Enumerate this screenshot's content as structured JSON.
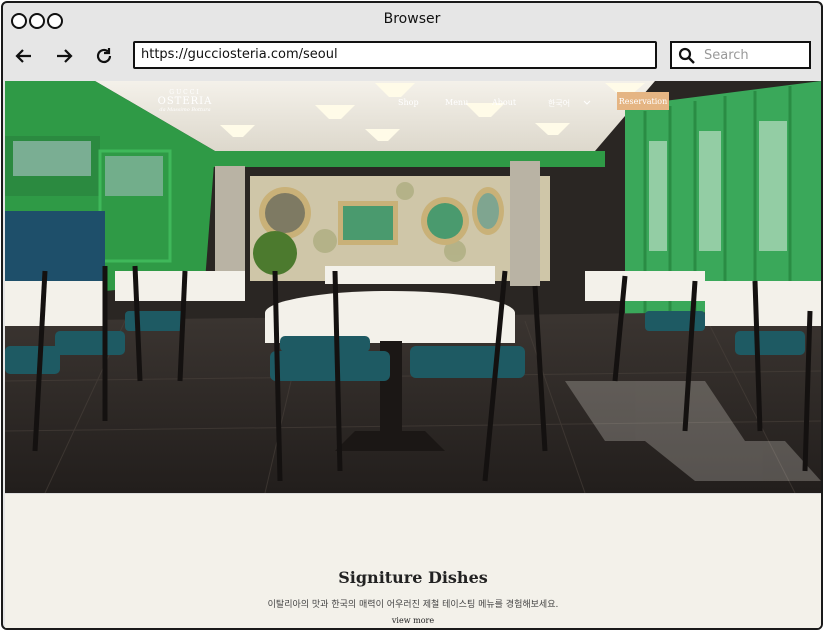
{
  "window": {
    "title": "Browser"
  },
  "toolbar": {
    "url": "https://gucciosteria.com/seoul",
    "search_placeholder": "Search"
  },
  "site": {
    "logo": {
      "line1": "GUCCI",
      "line2": "OSTERIA",
      "line3": "da Massimo Bottura"
    },
    "nav": {
      "shop": "Shop",
      "menu": "Menu",
      "about": "About",
      "language": "한국어",
      "reservation": "Reservation"
    },
    "section": {
      "title": "Signiture Dishes",
      "description": "이탈리아의 맛과 한국의 매력이 어우러진 제철 테이스팅 메뉴를 경험해보세요.",
      "view_more": "view more"
    }
  },
  "colors": {
    "accent": "#e5b583",
    "wall_green": "#2f9a46",
    "chair_teal": "#1e5a63"
  },
  "icons": [
    "back-arrow-icon",
    "forward-arrow-icon",
    "reload-icon",
    "search-icon",
    "chevron-down-icon"
  ]
}
